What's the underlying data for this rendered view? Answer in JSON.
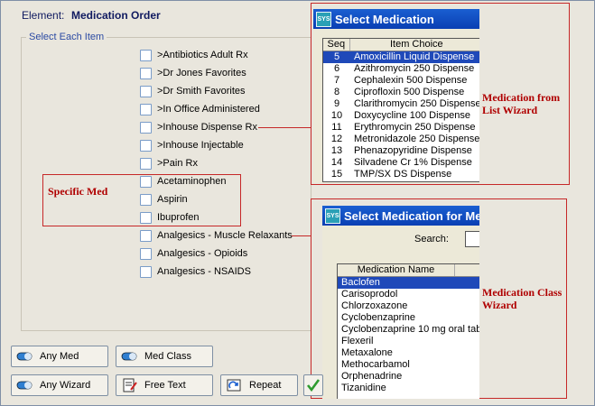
{
  "header": {
    "element_label": "Element:",
    "element_value": "Medication Order"
  },
  "group": {
    "title": "Select Each Item"
  },
  "items": [
    {
      "label": ">Antibiotics Adult Rx"
    },
    {
      "label": ">Dr Jones Favorites"
    },
    {
      "label": ">Dr Smith Favorites"
    },
    {
      "label": ">In Office Administered"
    },
    {
      "label": ">Inhouse Dispense Rx"
    },
    {
      "label": ">Inhouse Injectable"
    },
    {
      "label": ">Pain Rx"
    },
    {
      "label": "Acetaminophen"
    },
    {
      "label": "Aspirin"
    },
    {
      "label": "Ibuprofen"
    },
    {
      "label": "Analgesics - Muscle Relaxants"
    },
    {
      "label": "Analgesics - Opioids"
    },
    {
      "label": "Analgesics - NSAIDS"
    }
  ],
  "annotations": {
    "specific_med": "Specific Med",
    "list_wizard": "Medication from List Wizard",
    "class_wizard": "Medication Class Wizard"
  },
  "buttons": {
    "any_med": "Any Med",
    "med_class": "Med Class",
    "any_wizard": "Any Wizard",
    "free_text": "Free Text",
    "repeat": "Repeat"
  },
  "select_medication": {
    "title": "Select Medication",
    "col_seq": "Seq",
    "col_item": "Item Choice",
    "rows": [
      {
        "seq": "5",
        "item": "Amoxicillin Liquid Dispense"
      },
      {
        "seq": "6",
        "item": "Azithromycin 250 Dispense"
      },
      {
        "seq": "7",
        "item": "Cephalexin 500 Dispense"
      },
      {
        "seq": "8",
        "item": "Ciprofloxin 500 Dispense"
      },
      {
        "seq": "9",
        "item": "Clarithromycin 250 Dispense"
      },
      {
        "seq": "10",
        "item": "Doxycycline 100 Dispense"
      },
      {
        "seq": "11",
        "item": "Erythromycin 250 Dispense"
      },
      {
        "seq": "12",
        "item": "Metronidazole 250 Dispense"
      },
      {
        "seq": "13",
        "item": "Phenazopyridine Dispense"
      },
      {
        "seq": "14",
        "item": "Silvadene Cr 1% Dispense"
      },
      {
        "seq": "15",
        "item": "TMP/SX DS Dispense"
      }
    ]
  },
  "select_medication_for": {
    "title": "Select Medication for Me",
    "search_label": "Search:",
    "col_name": "Medication Name",
    "rows": [
      "Baclofen",
      "Carisoprodol",
      "Chlorzoxazone",
      "Cyclobenzaprine",
      "Cyclobenzaprine 10 mg oral tab",
      "Flexeril",
      "Metaxalone",
      "Methocarbamol",
      "Orphenadrine",
      "Tizanidine"
    ]
  },
  "colors": {
    "accent": "#1f49b9",
    "annotation": "#c62828",
    "titlebar": "#0a3fb3"
  }
}
